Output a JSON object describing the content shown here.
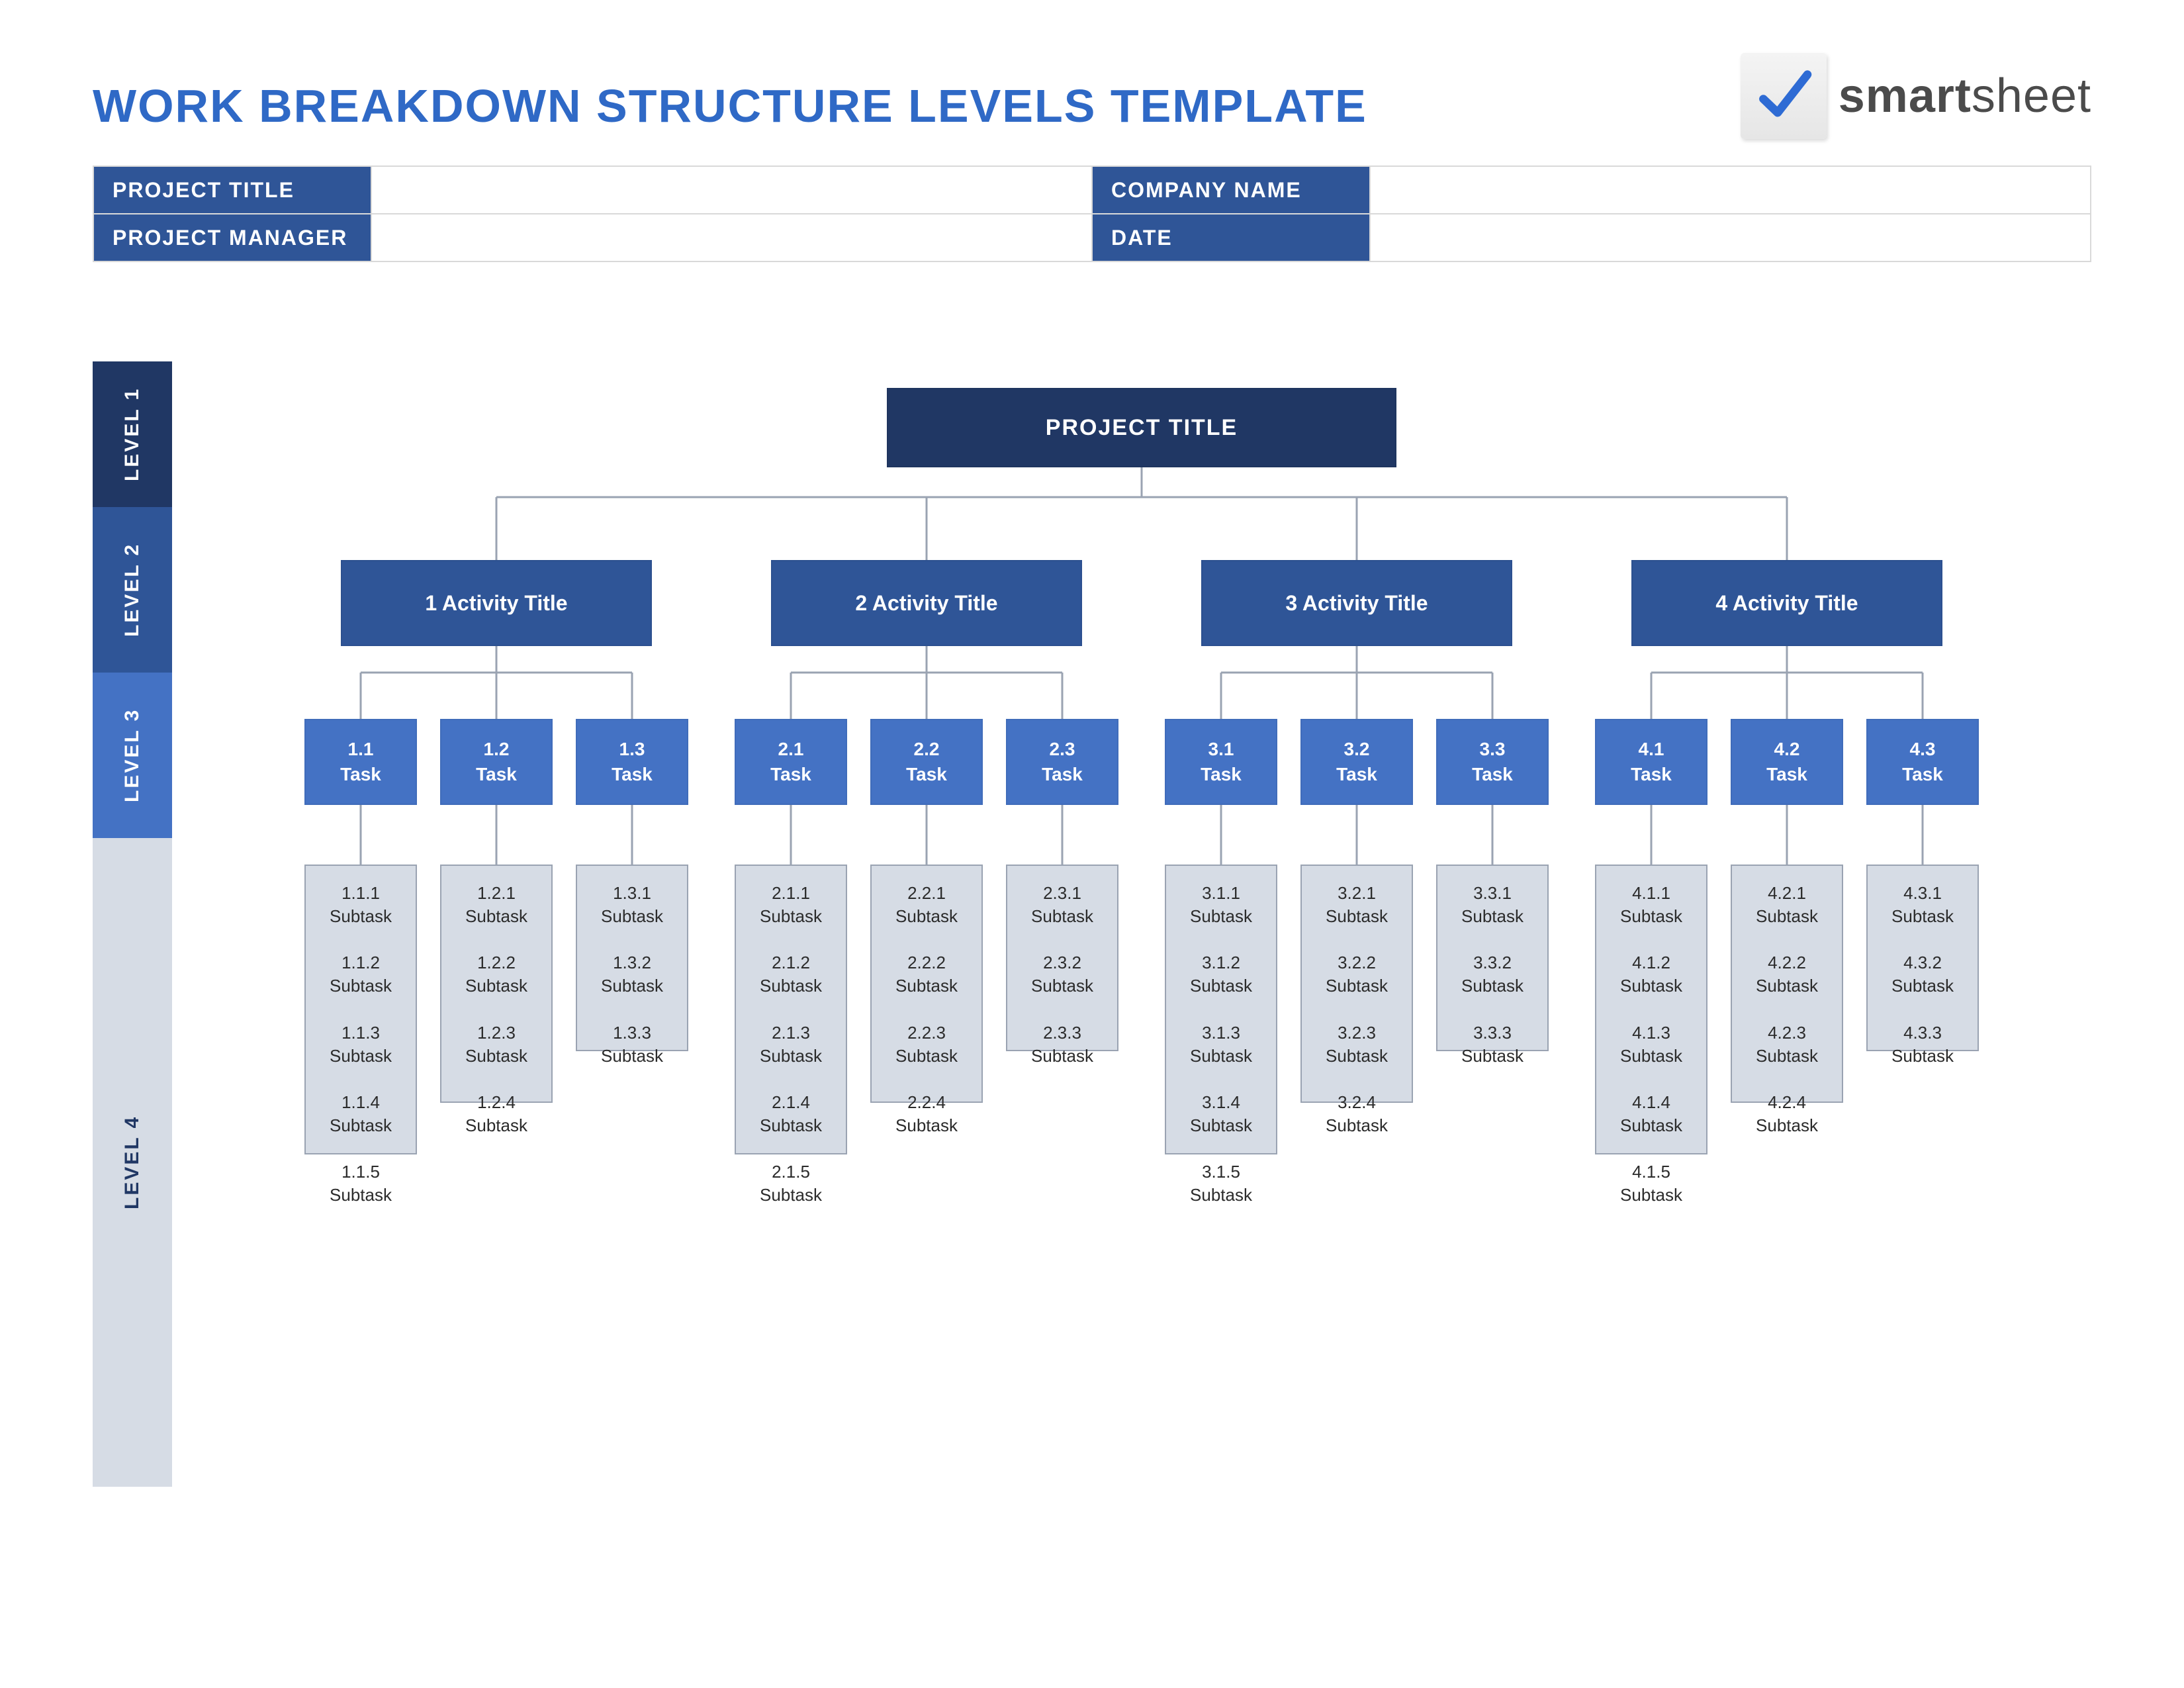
{
  "title": "WORK BREAKDOWN STRUCTURE LEVELS TEMPLATE",
  "logo": {
    "brand_bold": "smart",
    "brand_rest": "sheet"
  },
  "meta": {
    "project_title_label": "PROJECT TITLE",
    "project_title_value": "",
    "company_name_label": "COMPANY NAME",
    "company_name_value": "",
    "project_manager_label": "PROJECT MANAGER",
    "project_manager_value": "",
    "date_label": "DATE",
    "date_value": ""
  },
  "levels": {
    "l1": "LEVEL 1",
    "l2": "LEVEL 2",
    "l3": "LEVEL 3",
    "l4": "LEVEL 4"
  },
  "root": "PROJECT TITLE",
  "activities": [
    {
      "label": "1 Activity Title",
      "tasks": [
        {
          "label": "1.1\nTask",
          "subtasks": [
            "1.1.1\nSubtask",
            "1.1.2\nSubtask",
            "1.1.3\nSubtask",
            "1.1.4\nSubtask",
            "1.1.5\nSubtask"
          ]
        },
        {
          "label": "1.2\nTask",
          "subtasks": [
            "1.2.1\nSubtask",
            "1.2.2\nSubtask",
            "1.2.3\nSubtask",
            "1.2.4\nSubtask"
          ]
        },
        {
          "label": "1.3\nTask",
          "subtasks": [
            "1.3.1\nSubtask",
            "1.3.2\nSubtask",
            "1.3.3\nSubtask"
          ]
        }
      ]
    },
    {
      "label": "2 Activity Title",
      "tasks": [
        {
          "label": "2.1\nTask",
          "subtasks": [
            "2.1.1\nSubtask",
            "2.1.2\nSubtask",
            "2.1.3\nSubtask",
            "2.1.4\nSubtask",
            "2.1.5\nSubtask"
          ]
        },
        {
          "label": "2.2\nTask",
          "subtasks": [
            "2.2.1\nSubtask",
            "2.2.2\nSubtask",
            "2.2.3\nSubtask",
            "2.2.4\nSubtask"
          ]
        },
        {
          "label": "2.3\nTask",
          "subtasks": [
            "2.3.1\nSubtask",
            "2.3.2\nSubtask",
            "2.3.3\nSubtask"
          ]
        }
      ]
    },
    {
      "label": "3 Activity Title",
      "tasks": [
        {
          "label": "3.1\nTask",
          "subtasks": [
            "3.1.1\nSubtask",
            "3.1.2\nSubtask",
            "3.1.3\nSubtask",
            "3.1.4\nSubtask",
            "3.1.5\nSubtask"
          ]
        },
        {
          "label": "3.2\nTask",
          "subtasks": [
            "3.2.1\nSubtask",
            "3.2.2\nSubtask",
            "3.2.3\nSubtask",
            "3.2.4\nSubtask"
          ]
        },
        {
          "label": "3.3\nTask",
          "subtasks": [
            "3.3.1\nSubtask",
            "3.3.2\nSubtask",
            "3.3.3\nSubtask"
          ]
        }
      ]
    },
    {
      "label": "4 Activity Title",
      "tasks": [
        {
          "label": "4.1\nTask",
          "subtasks": [
            "4.1.1\nSubtask",
            "4.1.2\nSubtask",
            "4.1.3\nSubtask",
            "4.1.4\nSubtask",
            "4.1.5\nSubtask"
          ]
        },
        {
          "label": "4.2\nTask",
          "subtasks": [
            "4.2.1\nSubtask",
            "4.2.2\nSubtask",
            "4.2.3\nSubtask",
            "4.2.4\nSubtask"
          ]
        },
        {
          "label": "4.3\nTask",
          "subtasks": [
            "4.3.1\nSubtask",
            "4.3.2\nSubtask",
            "4.3.3\nSubtask"
          ]
        }
      ]
    }
  ],
  "colors": {
    "level1": "#203764",
    "level2": "#2f5597",
    "level3": "#4472c4",
    "level4_bg": "#d6dce5",
    "title": "#2f69c6"
  }
}
